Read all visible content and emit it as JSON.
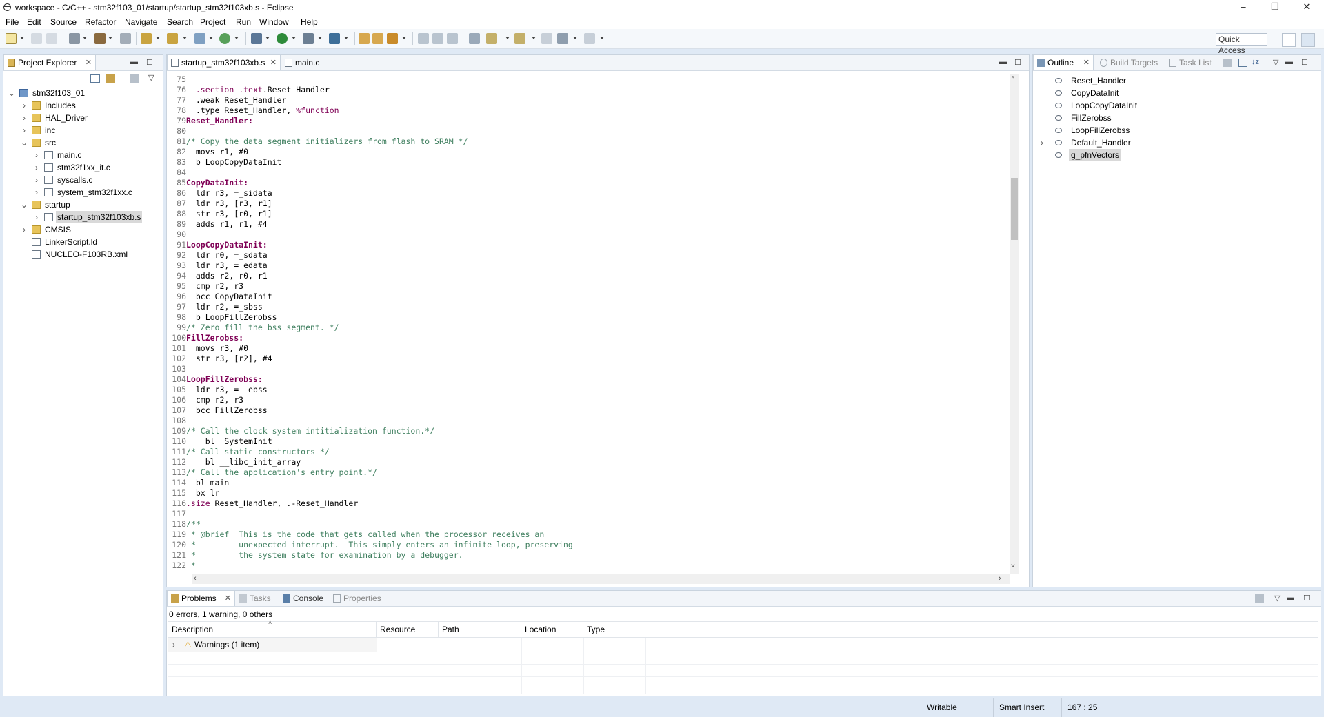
{
  "window": {
    "title": "workspace - C/C++ - stm32f103_01/startup/startup_stm32f103xb.s - Eclipse",
    "minimize": "–",
    "maximize": "❐",
    "close": "✕"
  },
  "menu": [
    "File",
    "Edit",
    "Source",
    "Refactor",
    "Navigate",
    "Search",
    "Project",
    "Run",
    "Window",
    "Help"
  ],
  "quick_access": "Quick Access",
  "project_explorer": {
    "tab_label": "Project Explorer",
    "tree": [
      {
        "label": "stm32f103_01",
        "icon": "project-icon",
        "chevron": "open"
      },
      {
        "label": "Includes",
        "icon": "includes-icon",
        "chevron": "closed"
      },
      {
        "label": "HAL_Driver",
        "icon": "folder-icon",
        "chevron": "closed"
      },
      {
        "label": "inc",
        "icon": "folder-icon",
        "chevron": "closed"
      },
      {
        "label": "src",
        "icon": "folder-icon",
        "chevron": "open"
      },
      {
        "label": "main.c",
        "icon": "c-file-icon",
        "chevron": "closed"
      },
      {
        "label": "stm32f1xx_it.c",
        "icon": "c-file-icon",
        "chevron": "closed"
      },
      {
        "label": "syscalls.c",
        "icon": "c-file-icon",
        "chevron": "closed"
      },
      {
        "label": "system_stm32f1xx.c",
        "icon": "c-file-icon",
        "chevron": "closed"
      },
      {
        "label": "startup",
        "icon": "folder-icon",
        "chevron": "open"
      },
      {
        "label": "startup_stm32f103xb.s",
        "icon": "asm-file-icon",
        "chevron": "closed",
        "selected": true
      },
      {
        "label": "CMSIS",
        "icon": "folder-icon",
        "chevron": "closed"
      },
      {
        "label": "LinkerScript.ld",
        "icon": "file-icon",
        "chevron": "none"
      },
      {
        "label": "NUCLEO-F103RB.xml",
        "icon": "xml-file-icon",
        "chevron": "none"
      }
    ]
  },
  "editor": {
    "tabs": [
      {
        "label": "startup_stm32f103xb.s",
        "active": true
      },
      {
        "label": "main.c",
        "active": false
      }
    ],
    "lines": [
      {
        "n": "75",
        "segs": []
      },
      {
        "n": "76",
        "segs": [
          {
            "t": "  "
          },
          {
            "t": ".section",
            "c": "kw"
          },
          {
            "t": " "
          },
          {
            "t": ".text",
            "c": "kw"
          },
          {
            "t": ".Reset_Handler"
          }
        ]
      },
      {
        "n": "77",
        "segs": [
          {
            "t": "  .weak Reset_Handler"
          }
        ]
      },
      {
        "n": "78",
        "segs": [
          {
            "t": "  .type Reset_Handler, "
          },
          {
            "t": "%function",
            "c": "kw"
          }
        ]
      },
      {
        "n": "79",
        "segs": [
          {
            "t": "Reset_Handler:",
            "c": "lbl"
          }
        ]
      },
      {
        "n": "80",
        "segs": []
      },
      {
        "n": "81",
        "segs": [
          {
            "t": "/* Copy the data segment initializers from flash to SRAM */",
            "c": "cmt"
          }
        ]
      },
      {
        "n": "82",
        "segs": [
          {
            "t": "  movs r1, #0"
          }
        ]
      },
      {
        "n": "83",
        "segs": [
          {
            "t": "  b LoopCopyDataInit"
          }
        ]
      },
      {
        "n": "84",
        "segs": []
      },
      {
        "n": "85",
        "segs": [
          {
            "t": "CopyDataInit:",
            "c": "lbl"
          }
        ]
      },
      {
        "n": "86",
        "segs": [
          {
            "t": "  ldr r3, =_sidata"
          }
        ]
      },
      {
        "n": "87",
        "segs": [
          {
            "t": "  ldr r3, [r3, r1]"
          }
        ]
      },
      {
        "n": "88",
        "segs": [
          {
            "t": "  str r3, [r0, r1]"
          }
        ]
      },
      {
        "n": "89",
        "segs": [
          {
            "t": "  adds r1, r1, #4"
          }
        ]
      },
      {
        "n": "90",
        "segs": []
      },
      {
        "n": "91",
        "segs": [
          {
            "t": "LoopCopyDataInit:",
            "c": "lbl"
          }
        ]
      },
      {
        "n": "92",
        "segs": [
          {
            "t": "  ldr r0, =_sdata"
          }
        ]
      },
      {
        "n": "93",
        "segs": [
          {
            "t": "  ldr r3, =_edata"
          }
        ]
      },
      {
        "n": "94",
        "segs": [
          {
            "t": "  adds r2, r0, r1"
          }
        ]
      },
      {
        "n": "95",
        "segs": [
          {
            "t": "  cmp r2, r3"
          }
        ]
      },
      {
        "n": "96",
        "segs": [
          {
            "t": "  bcc CopyDataInit"
          }
        ]
      },
      {
        "n": "97",
        "segs": [
          {
            "t": "  ldr r2, =_sbss"
          }
        ]
      },
      {
        "n": "98",
        "segs": [
          {
            "t": "  b LoopFillZerobss"
          }
        ]
      },
      {
        "n": "99",
        "segs": [
          {
            "t": "/* Zero fill the bss segment. */",
            "c": "cmt"
          }
        ]
      },
      {
        "n": "100",
        "segs": [
          {
            "t": "FillZerobss:",
            "c": "lbl"
          }
        ]
      },
      {
        "n": "101",
        "segs": [
          {
            "t": "  movs r3, #0"
          }
        ]
      },
      {
        "n": "102",
        "segs": [
          {
            "t": "  str r3, [r2], #4"
          }
        ]
      },
      {
        "n": "103",
        "segs": []
      },
      {
        "n": "104",
        "segs": [
          {
            "t": "LoopFillZerobss:",
            "c": "lbl"
          }
        ]
      },
      {
        "n": "105",
        "segs": [
          {
            "t": "  ldr r3, = _ebss"
          }
        ]
      },
      {
        "n": "106",
        "segs": [
          {
            "t": "  cmp r2, r3"
          }
        ]
      },
      {
        "n": "107",
        "segs": [
          {
            "t": "  bcc FillZerobss"
          }
        ]
      },
      {
        "n": "108",
        "segs": []
      },
      {
        "n": "109",
        "segs": [
          {
            "t": "/* Call the clock system intitialization function.*/",
            "c": "cmt"
          }
        ]
      },
      {
        "n": "110",
        "segs": [
          {
            "t": "    bl  SystemInit"
          }
        ]
      },
      {
        "n": "111",
        "segs": [
          {
            "t": "/* Call static constructors */",
            "c": "cmt"
          }
        ]
      },
      {
        "n": "112",
        "segs": [
          {
            "t": "    bl __libc_init_array"
          }
        ]
      },
      {
        "n": "113",
        "segs": [
          {
            "t": "/* Call the application's entry point.*/",
            "c": "cmt"
          }
        ]
      },
      {
        "n": "114",
        "segs": [
          {
            "t": "  bl main"
          }
        ]
      },
      {
        "n": "115",
        "segs": [
          {
            "t": "  bx lr"
          }
        ]
      },
      {
        "n": "116",
        "segs": [
          {
            "t": ".size",
            "c": "kw"
          },
          {
            "t": " Reset_Handler, .-Reset_Handler"
          }
        ]
      },
      {
        "n": "117",
        "segs": []
      },
      {
        "n": "118",
        "segs": [
          {
            "t": "/**",
            "c": "cmt"
          }
        ]
      },
      {
        "n": "119",
        "segs": [
          {
            "t": " * @brief  This is the code that gets called when the processor receives an",
            "c": "cmt"
          }
        ]
      },
      {
        "n": "120",
        "segs": [
          {
            "t": " *         unexpected interrupt.  This simply enters an infinite loop, preserving",
            "c": "cmt"
          }
        ]
      },
      {
        "n": "121",
        "segs": [
          {
            "t": " *         the system state for examination by a debugger.",
            "c": "cmt"
          }
        ]
      },
      {
        "n": "122",
        "segs": [
          {
            "t": " *",
            "c": "cmt"
          }
        ]
      }
    ]
  },
  "outline": {
    "tabs": [
      {
        "label": "Outline",
        "active": true
      },
      {
        "label": "Build Targets",
        "active": false
      },
      {
        "label": "Task List",
        "active": false
      }
    ],
    "items": [
      {
        "label": "Reset_Handler"
      },
      {
        "label": "CopyDataInit"
      },
      {
        "label": "LoopCopyDataInit"
      },
      {
        "label": "FillZerobss"
      },
      {
        "label": "LoopFillZerobss"
      },
      {
        "label": "Default_Handler",
        "expandable": true
      },
      {
        "label": "g_pfnVectors",
        "selected": true
      }
    ]
  },
  "bottom": {
    "tabs": [
      {
        "label": "Problems",
        "active": true
      },
      {
        "label": "Tasks",
        "active": false
      },
      {
        "label": "Console",
        "active": false
      },
      {
        "label": "Properties",
        "active": false
      }
    ],
    "summary": "0 errors, 1 warning, 0 others",
    "columns": [
      "Description",
      "Resource",
      "Path",
      "Location",
      "Type"
    ],
    "rows": [
      {
        "description": "Warnings (1 item)",
        "icon": "warning-icon"
      }
    ]
  },
  "status": {
    "writable": "Writable",
    "insert_mode": "Smart Insert",
    "position": "167 : 25"
  },
  "colors": {
    "accent": "#dfe9f5",
    "label": "#7f0055",
    "comment": "#3f7f5f",
    "selection": "#d9d9d9"
  }
}
